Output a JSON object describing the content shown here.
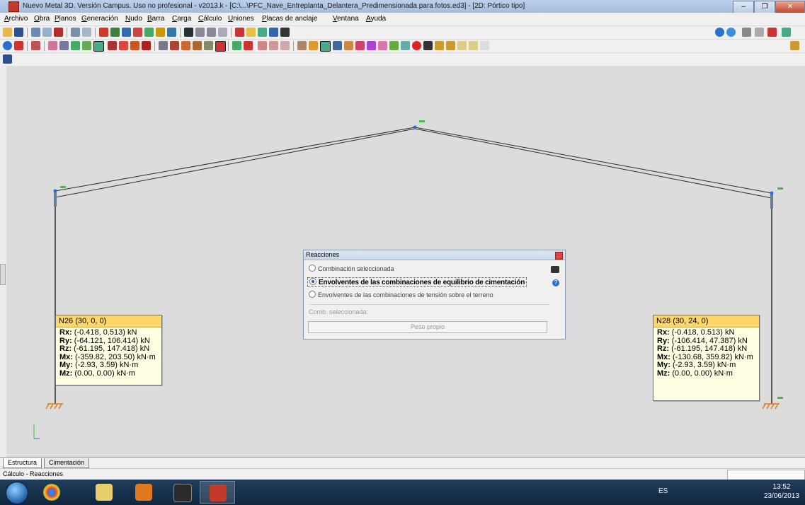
{
  "window": {
    "title": "Nuevo Metal 3D. Versión Campus. Uso no profesional - v2013.k - [C:\\...\\PFC_Nave_Entreplanta_Delantera_Predimensionada para fotos.ed3] - [2D: Pórtico tipo]"
  },
  "menu": {
    "items": [
      "Archivo",
      "Obra",
      "Planos",
      "Generación",
      "Nudo",
      "Barra",
      "Carga",
      "Cálculo",
      "Uniones",
      "Placas de anclaje",
      "Ventana",
      "Ayuda"
    ]
  },
  "dialog": {
    "title": "Reacciones",
    "options": [
      {
        "label": "Combinación seleccionada",
        "selected": false
      },
      {
        "label": "Envolventes de las combinaciones de equilibrio de cimentación",
        "selected": true
      },
      {
        "label": "Envolventes de las combinaciones de tensión sobre el terreno",
        "selected": false
      }
    ],
    "comb_label": "Comb. seleccionada:",
    "comb_value": "Peso propio",
    "icons": [
      "book-icon",
      "help-icon"
    ]
  },
  "nodes": [
    {
      "title": "N26 (30, 0, 0)",
      "rows": [
        {
          "k": "Rx:",
          "v": " (-0.418, 0.513) kN"
        },
        {
          "k": "Ry:",
          "v": " (-64.121, 106.414) kN"
        },
        {
          "k": "Rz:",
          "v": " (-61.195, 147.418) kN"
        },
        {
          "k": "Mx:",
          "v": " (-359.82, 203.50) kN·m"
        },
        {
          "k": "My:",
          "v": " (-2.93, 3.59) kN·m"
        },
        {
          "k": "Mz:",
          "v": " (0.00, 0.00) kN·m"
        }
      ]
    },
    {
      "title": "N28 (30, 24, 0)",
      "rows": [
        {
          "k": "Rx:",
          "v": " (-0.418, 0.513) kN"
        },
        {
          "k": "Ry:",
          "v": " (-106.414, 47.387) kN"
        },
        {
          "k": "Rz:",
          "v": " (-61.195, 147.418) kN"
        },
        {
          "k": "Mx:",
          "v": " (-130.68, 359.82) kN·m"
        },
        {
          "k": "My:",
          "v": " (-2.93, 3.59) kN·m"
        },
        {
          "k": "Mz:",
          "v": " (0.00, 0.00) kN·m"
        }
      ]
    }
  ],
  "tabs": [
    "Estructura",
    "Cimentación"
  ],
  "status": {
    "message": "Cálculo - Reacciones"
  },
  "taskbar": {
    "language": "ES",
    "time": "13:52",
    "date": "23/06/2013"
  },
  "colors": {
    "node_panel_header": "#ffd66a",
    "node_panel_body": "#ffffe3",
    "canvas": "#dcdcdc",
    "taskbar": "#1f3d5c"
  }
}
